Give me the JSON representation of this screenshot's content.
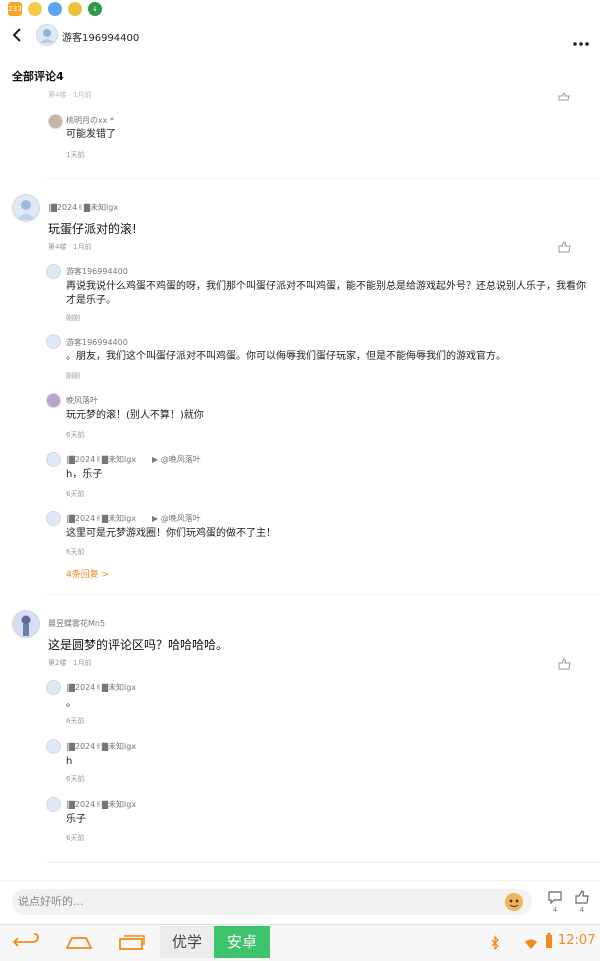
{
  "header": {
    "user_name": "游客196994400",
    "section_title": "全部评论4"
  },
  "status_icons": [
    "233",
    "emoji",
    "shield",
    "gear",
    "download"
  ],
  "partial_top": {
    "meta": "第4楼 · 1月前"
  },
  "top_reply": {
    "name": "桃明月のxx *",
    "text": "可能发错了",
    "meta": "1天前"
  },
  "comment1": {
    "name": "|▇2024✌▇未知lgx",
    "text": "玩蛋仔派对的滚!",
    "meta": "第4楼 · 1月前",
    "replies": [
      {
        "name": "游客196994400",
        "text": "再说我说什么鸡蛋不鸡蛋的呀，我们那个叫蛋仔派对不叫鸡蛋，能不能别总是给游戏起外号？还总说别人乐子，我看你才是乐子。",
        "meta": "刚刚"
      },
      {
        "name": "游客196994400",
        "text": "。朋友，我们这个叫蛋仔派对不叫鸡蛋。你可以侮辱我们蛋仔玩家，但是不能侮辱我们的游戏官方。",
        "meta": "刚刚"
      },
      {
        "name": "晚风落叶",
        "text": "玩元梦的滚！(别人不算！)就你",
        "meta": "6天前"
      },
      {
        "name": "|▇2024✌▇未知lgx",
        "target": "▶ @晚风落叶",
        "text": "h，乐子",
        "meta": "6天前"
      },
      {
        "name": "|▇2024✌▇未知lgx",
        "target": "▶ @晚风落叶",
        "text": "这里可是元梦游戏圈！你们玩鸡蛋的做不了主！",
        "meta": "6天前"
      }
    ],
    "more_replies": "4条回复 >"
  },
  "comment2": {
    "name": "晨昱蝶雾花Mn5",
    "text": "这是圆梦的评论区吗？哈哈哈哈。",
    "meta": "第2楼 · 1月前",
    "replies": [
      {
        "name": "|▇2024✌▇未知lgx",
        "text": "。",
        "meta": "6天前"
      },
      {
        "name": "|▇2024✌▇未知lgx",
        "text": "h",
        "meta": "6天前"
      },
      {
        "name": "|▇2024✌▇未知lgx",
        "text": "乐子",
        "meta": "6天前"
      }
    ]
  },
  "bottom": {
    "input_placeholder": "说点好听的...",
    "comment_count": "4",
    "like_count": "4"
  },
  "navbar": {
    "ime1": "优学",
    "ime2": "安卓",
    "time": "12:07"
  },
  "colors": {
    "accent": "#f08a1d",
    "ime_green": "#3ec46d"
  }
}
